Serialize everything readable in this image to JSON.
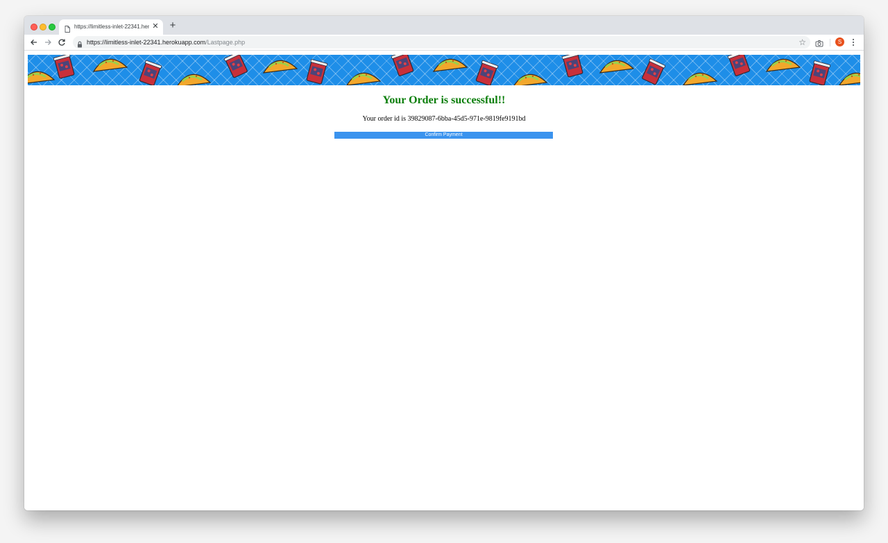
{
  "browser": {
    "tab_title": "https://limitless-inlet-22341.herokuapp.com/Lastpage.php",
    "new_tab_label": "+",
    "url_host": "https://limitless-inlet-22341.herokuapp.com",
    "url_path": "/Lastpage.php",
    "profile_initial": "S",
    "icons": [
      "document-icon",
      "close-icon",
      "back-arrow-icon",
      "forward-arrow-icon",
      "reload-icon",
      "lock-icon",
      "star-icon",
      "camera-icon",
      "menu-dots-icon"
    ]
  },
  "page": {
    "headline": "Your Order is successful!!",
    "order_text": "Your order id is 39829087-6bba-45d5-971e-9819fe9191bd",
    "confirm_label": "Confirm Payment"
  },
  "colors": {
    "headline": "#0a7e0a",
    "button": "#3b93ee",
    "banner": "#1e8ee8",
    "avatar": "#e8501c"
  }
}
